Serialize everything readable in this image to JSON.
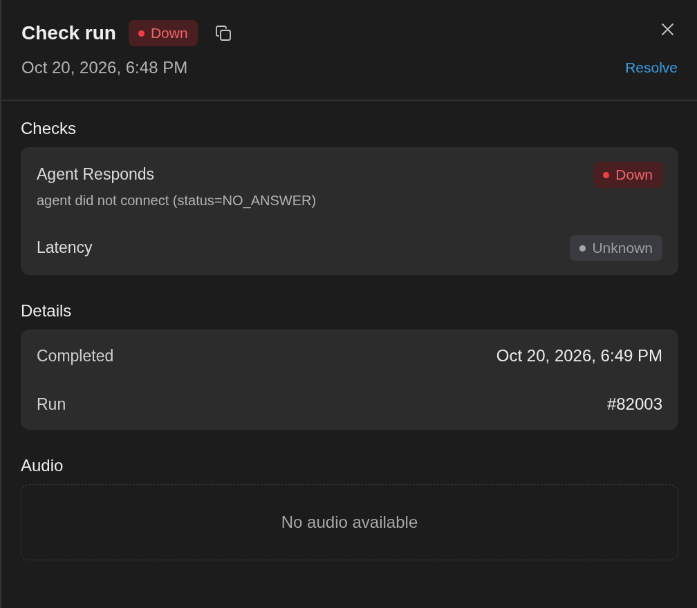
{
  "header": {
    "title": "Check run",
    "status": {
      "label": "Down",
      "kind": "down"
    },
    "timestamp": "Oct 20, 2026, 6:48 PM",
    "action": "Resolve"
  },
  "sections": [
    {
      "kind": "checks",
      "title": "Checks",
      "items": [
        {
          "name": "Agent Responds",
          "message": "agent did not connect (status=NO_ANSWER)",
          "status": {
            "label": "Down",
            "kind": "down"
          }
        },
        {
          "name": "Latency",
          "status": {
            "label": "Unknown",
            "kind": "unknown"
          }
        }
      ]
    },
    {
      "kind": "details",
      "title": "Details",
      "rows": [
        {
          "label": "Completed",
          "value": "Oct 20, 2026, 6:49 PM"
        },
        {
          "label": "Run",
          "value": "#82003"
        }
      ]
    },
    {
      "kind": "audio",
      "title": "Audio",
      "empty_text": "No audio available"
    }
  ]
}
